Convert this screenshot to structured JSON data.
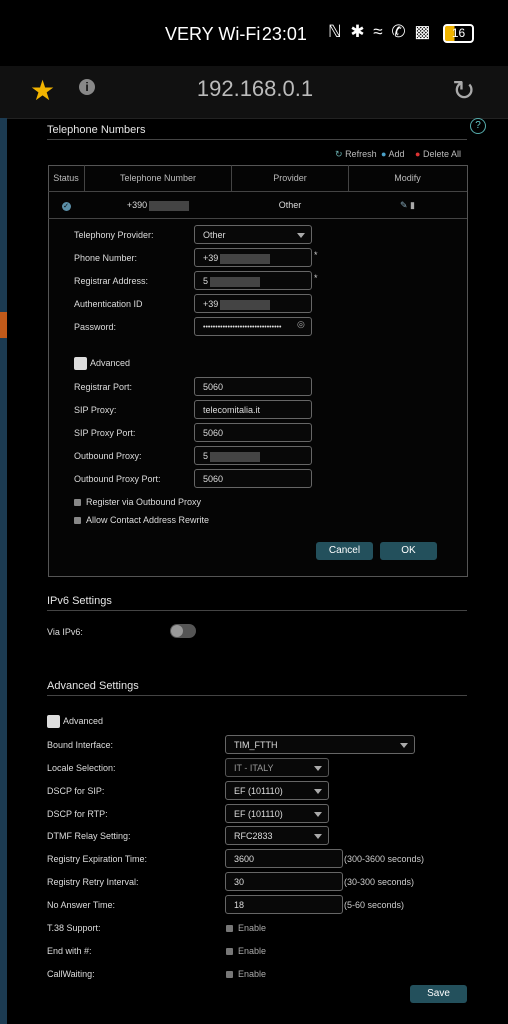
{
  "status_bar": {
    "carrier": "VERY Wi-Fi",
    "time": "23:01",
    "battery": "16"
  },
  "browser": {
    "url": "192.168.0.1"
  },
  "telephone": {
    "section_title": "Telephone Numbers",
    "refresh": "Refresh",
    "add": "Add",
    "delete_all": "Delete All",
    "columns": [
      "Status",
      "Telephone Number",
      "Provider",
      "Modify"
    ],
    "row": {
      "number": "+390",
      "provider": "Other"
    },
    "form": {
      "telephony_provider_label": "Telephony Provider:",
      "telephony_provider_value": "Other",
      "phone_number_label": "Phone Number:",
      "phone_number_value": "+39",
      "registrar_address_label": "Registrar Address:",
      "registrar_address_value": "5",
      "auth_id_label": "Authentication ID",
      "auth_id_value": "+39",
      "password_label": "Password:",
      "password_value": "••••••••••••••••••••••••••••••••",
      "advanced": "Advanced",
      "registrar_port_label": "Registrar Port:",
      "registrar_port_value": "5060",
      "sip_proxy_label": "SIP Proxy:",
      "sip_proxy_value": "telecomitalia.it",
      "sip_proxy_port_label": "SIP Proxy Port:",
      "sip_proxy_port_value": "5060",
      "outbound_proxy_label": "Outbound Proxy:",
      "outbound_proxy_value": "5",
      "outbound_proxy_port_label": "Outbound Proxy Port:",
      "outbound_proxy_port_value": "5060",
      "register_outbound": "Register via Outbound Proxy",
      "allow_contact": "Allow Contact Address Rewrite",
      "cancel": "Cancel",
      "ok": "OK",
      "required": "*"
    }
  },
  "ipv6": {
    "section_title": "IPv6 Settings",
    "via_ipv6_label": "Via IPv6:",
    "via_ipv6_on": false
  },
  "advanced_settings": {
    "section_title": "Advanced Settings",
    "advanced": "Advanced",
    "bound_interface_label": "Bound Interface:",
    "bound_interface_value": "TIM_FTTH",
    "locale_label": "Locale Selection:",
    "locale_value": "IT - ITALY",
    "dscp_sip_label": "DSCP for SIP:",
    "dscp_sip_value": "EF (101110)",
    "dscp_rtp_label": "DSCP for RTP:",
    "dscp_rtp_value": "EF (101110)",
    "dtmf_label": "DTMF Relay Setting:",
    "dtmf_value": "RFC2833",
    "reg_exp_label": "Registry Expiration Time:",
    "reg_exp_value": "3600",
    "reg_exp_suffix": "(300-3600 seconds)",
    "reg_retry_label": "Registry Retry Interval:",
    "reg_retry_value": "30",
    "reg_retry_suffix": "(30-300 seconds)",
    "no_answer_label": "No Answer Time:",
    "no_answer_value": "18",
    "no_answer_suffix": "(5-60 seconds)",
    "t38_label": "T.38 Support:",
    "end_hash_label": "End with #:",
    "call_waiting_label": "CallWaiting:",
    "enable": "Enable",
    "save": "Save"
  }
}
